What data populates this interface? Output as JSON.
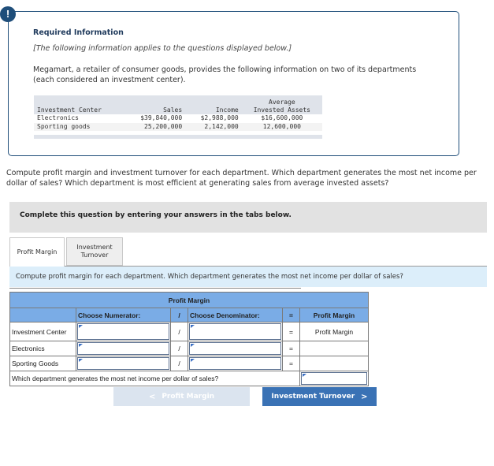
{
  "required_info": {
    "icon": "exclamation-icon",
    "icon_glyph": "!",
    "title": "Required Information",
    "note": "[The following information applies to the questions displayed below.]",
    "description": "Megamart, a retailer of consumer goods, provides the following information on two of its departments (each considered an investment center).",
    "table": {
      "headers": {
        "center": "Investment Center",
        "sales": "Sales",
        "income": "Income",
        "assets_line1": "Average",
        "assets_line2": "Invested Assets"
      },
      "rows": [
        {
          "center": "Electronics",
          "sales": "$39,840,000",
          "income": "$2,988,000",
          "assets": "$16,600,000"
        },
        {
          "center": "Sporting goods",
          "sales": "25,200,000",
          "income": "2,142,000",
          "assets": "12,600,000"
        }
      ]
    }
  },
  "question": "Compute profit margin and investment turnover for each department. Which department generates the most net income per dollar of sales? Which department is most efficient at generating sales from average invested assets?",
  "complete_bar": "Complete this question by entering your answers in the tabs below.",
  "tabs": [
    {
      "label": "Profit Margin",
      "active": true
    },
    {
      "label_line1": "Investment",
      "label_line2": "Turnover",
      "active": false
    }
  ],
  "instruction": "Compute profit margin for each department. Which department generates the most net income per dollar of sales?",
  "profit_margin_table": {
    "title": "Profit Margin",
    "headers": {
      "numerator": "Choose Numerator:",
      "slash": "/",
      "denominator": "Choose Denominator:",
      "equals": "=",
      "result": "Profit Margin"
    },
    "rows": [
      {
        "label": "Investment Center",
        "numerator": "",
        "slash": "/",
        "denominator": "",
        "equals": "=",
        "result": "Profit Margin"
      },
      {
        "label": "Electronics",
        "numerator": "",
        "slash": "/",
        "denominator": "",
        "equals": "=",
        "result": ""
      },
      {
        "label": "Sporting Goods",
        "numerator": "",
        "slash": "/",
        "denominator": "",
        "equals": "=",
        "result": ""
      }
    ],
    "final_question": "Which department generates the most net income per dollar of sales?",
    "final_answer": ""
  },
  "nav": {
    "prev_label": "Profit Margin",
    "prev_icon": "chevron-left-icon",
    "prev_glyph": "<",
    "next_label": "Investment Turnover",
    "next_icon": "chevron-right-icon",
    "next_glyph": ">"
  }
}
